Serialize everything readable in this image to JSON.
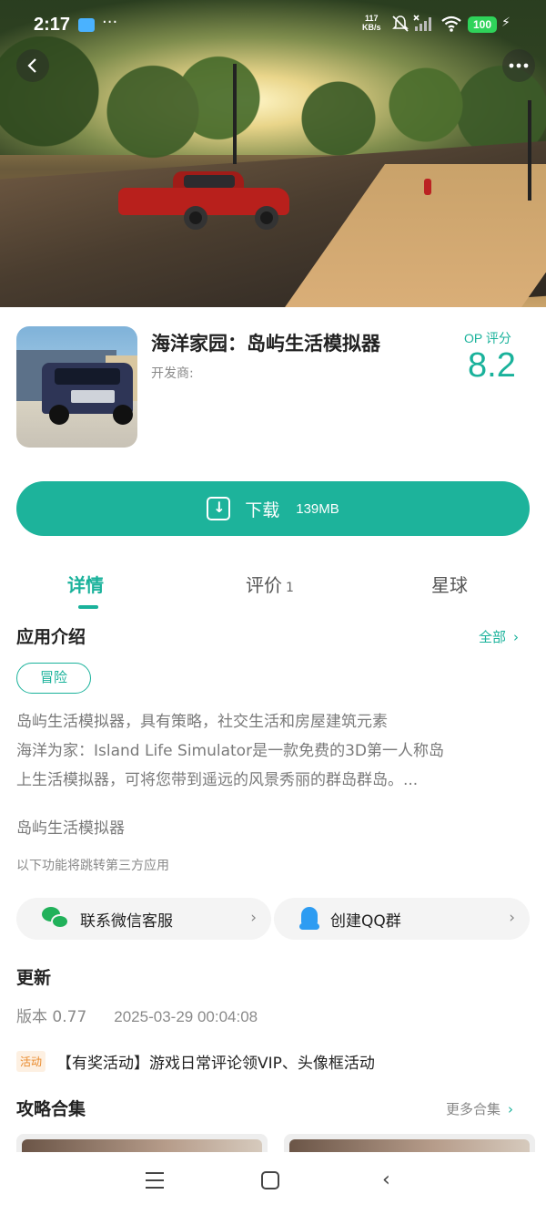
{
  "status_bar": {
    "time": "2:17",
    "dots": "···",
    "net_rate_value": "117",
    "net_rate_unit": "KB/s",
    "battery": "100"
  },
  "app": {
    "title": "海洋家园：岛屿生活模拟器",
    "developer_label": "开发商:",
    "score_label": "OP 评分",
    "score": "8.2"
  },
  "download": {
    "label": "下载",
    "size": "139MB"
  },
  "tabs": [
    {
      "label": "详情",
      "active": true
    },
    {
      "label": "评价",
      "count": "1"
    },
    {
      "label": "星球"
    }
  ],
  "intro": {
    "title": "应用介绍",
    "more": "全部",
    "tag": "冒险",
    "lines": [
      "岛屿生活模拟器，具有策略，社交生活和房屋建筑元素",
      "海洋为家：Island Life Simulator是一款免费的3D第一人称岛",
      "上生活模拟器，可将您带到遥远的风景秀丽的群岛群岛。..."
    ],
    "name": "岛屿生活模拟器",
    "third_party_note": "以下功能将跳转第三方应用"
  },
  "contacts": {
    "wechat": "联系微信客服",
    "qq": "创建QQ群"
  },
  "update": {
    "title": "更新",
    "version": "版本 0.77",
    "date": "2025-03-29 00:04:08"
  },
  "activity": {
    "badge": "活动",
    "text": "【有奖活动】游戏日常评论领VIP、头像框活动"
  },
  "guides": {
    "title": "攻略合集",
    "more": "更多合集"
  },
  "colors": {
    "accent": "#1ab29b",
    "download_button": "#1db39b",
    "activity_badge": "#e98a2b"
  }
}
